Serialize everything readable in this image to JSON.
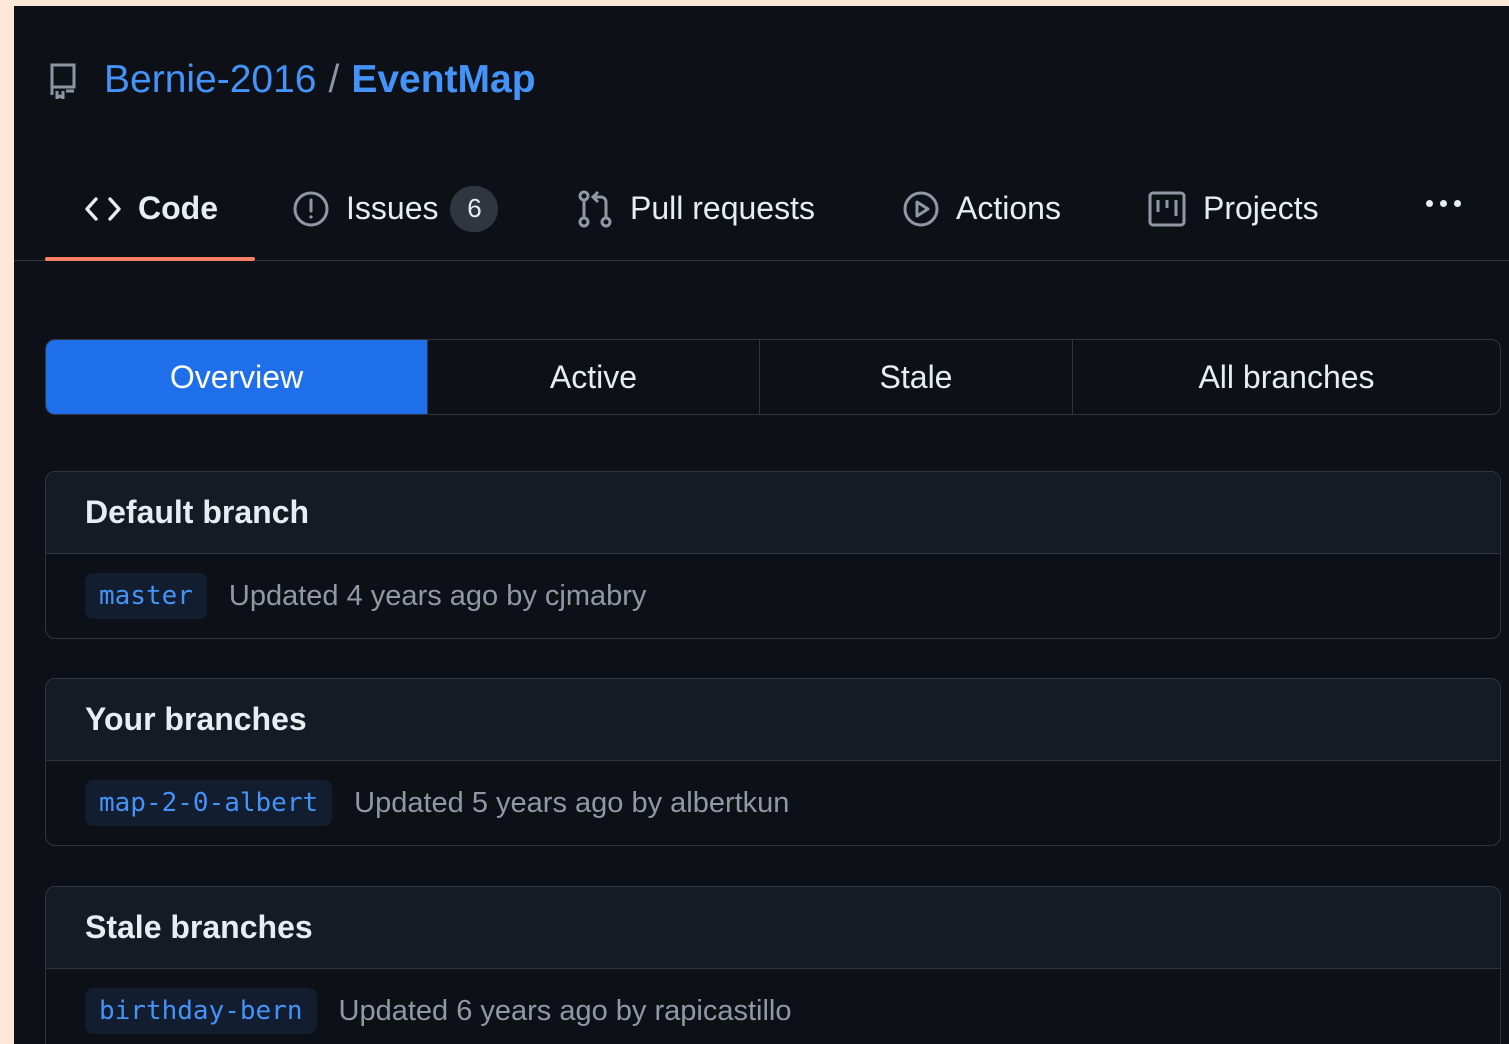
{
  "repo": {
    "owner": "Bernie-2016",
    "separator": "/",
    "name": "EventMap"
  },
  "nav": {
    "tabs": [
      {
        "label": "Code",
        "icon": "code-icon",
        "selected": true
      },
      {
        "label": "Issues",
        "icon": "issue-opened-icon",
        "count": "6"
      },
      {
        "label": "Pull requests",
        "icon": "git-pull-request-icon"
      },
      {
        "label": "Actions",
        "icon": "play-icon"
      },
      {
        "label": "Projects",
        "icon": "project-board-icon"
      }
    ],
    "more_icon": "kebab-horizontal-icon"
  },
  "filters": {
    "items": [
      {
        "label": "Overview",
        "active": true
      },
      {
        "label": "Active"
      },
      {
        "label": "Stale"
      },
      {
        "label": "All branches"
      }
    ]
  },
  "sections": [
    {
      "title": "Default branch",
      "branch": "master",
      "meta": "Updated 4 years ago by cjmabry"
    },
    {
      "title": "Your branches",
      "branch": "map-2-0-albert",
      "meta": "Updated 5 years ago by albertkun"
    },
    {
      "title": "Stale branches",
      "branch": "birthday-bern",
      "meta": "Updated 6 years ago by rapicastillo"
    }
  ],
  "colors": {
    "background": "#0d1117",
    "accent": "#1f6feb",
    "link": "#4493f8",
    "underline": "#f78166",
    "outer": "#fde8d7"
  }
}
